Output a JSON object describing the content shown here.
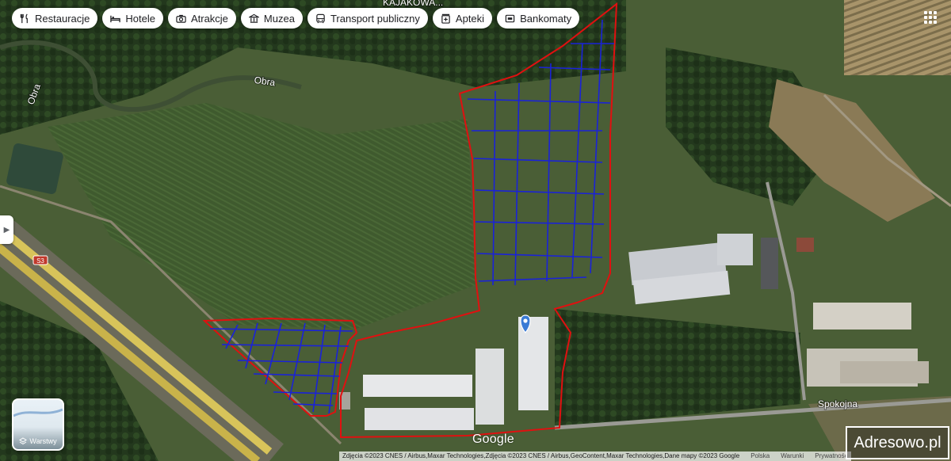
{
  "categories": [
    {
      "label": "Restauracje",
      "icon": "fork-knife-icon"
    },
    {
      "label": "Hotele",
      "icon": "bed-icon"
    },
    {
      "label": "Atrakcje",
      "icon": "camera-icon"
    },
    {
      "label": "Muzea",
      "icon": "museum-icon"
    },
    {
      "label": "Transport publiczny",
      "icon": "bus-icon"
    },
    {
      "label": "Apteki",
      "icon": "pharmacy-icon"
    },
    {
      "label": "Bankomaty",
      "icon": "atm-icon"
    }
  ],
  "map_labels": {
    "river_1": "Obra",
    "river_2": "Obra",
    "road_top": "KAJAKOWA...",
    "street": "Spokojna",
    "highway_shield": "S3"
  },
  "layers": {
    "label": "Warstwy"
  },
  "google_logo": "Google",
  "attribution": {
    "imagery": "Zdjęcia ©2023 CNES / Airbus,Maxar Technologies,Zdjęcia ©2023 CNES / Airbus,GeoContent,Maxar Technologies,Dane mapy ©2023 Google",
    "country": "Polska",
    "terms": "Warunki",
    "privacy": "Prywatność"
  },
  "watermark": "Adresowo.pl",
  "colors": {
    "boundary": "#e01010",
    "grid": "#1a22d8",
    "marker": "#3a7bd5"
  }
}
